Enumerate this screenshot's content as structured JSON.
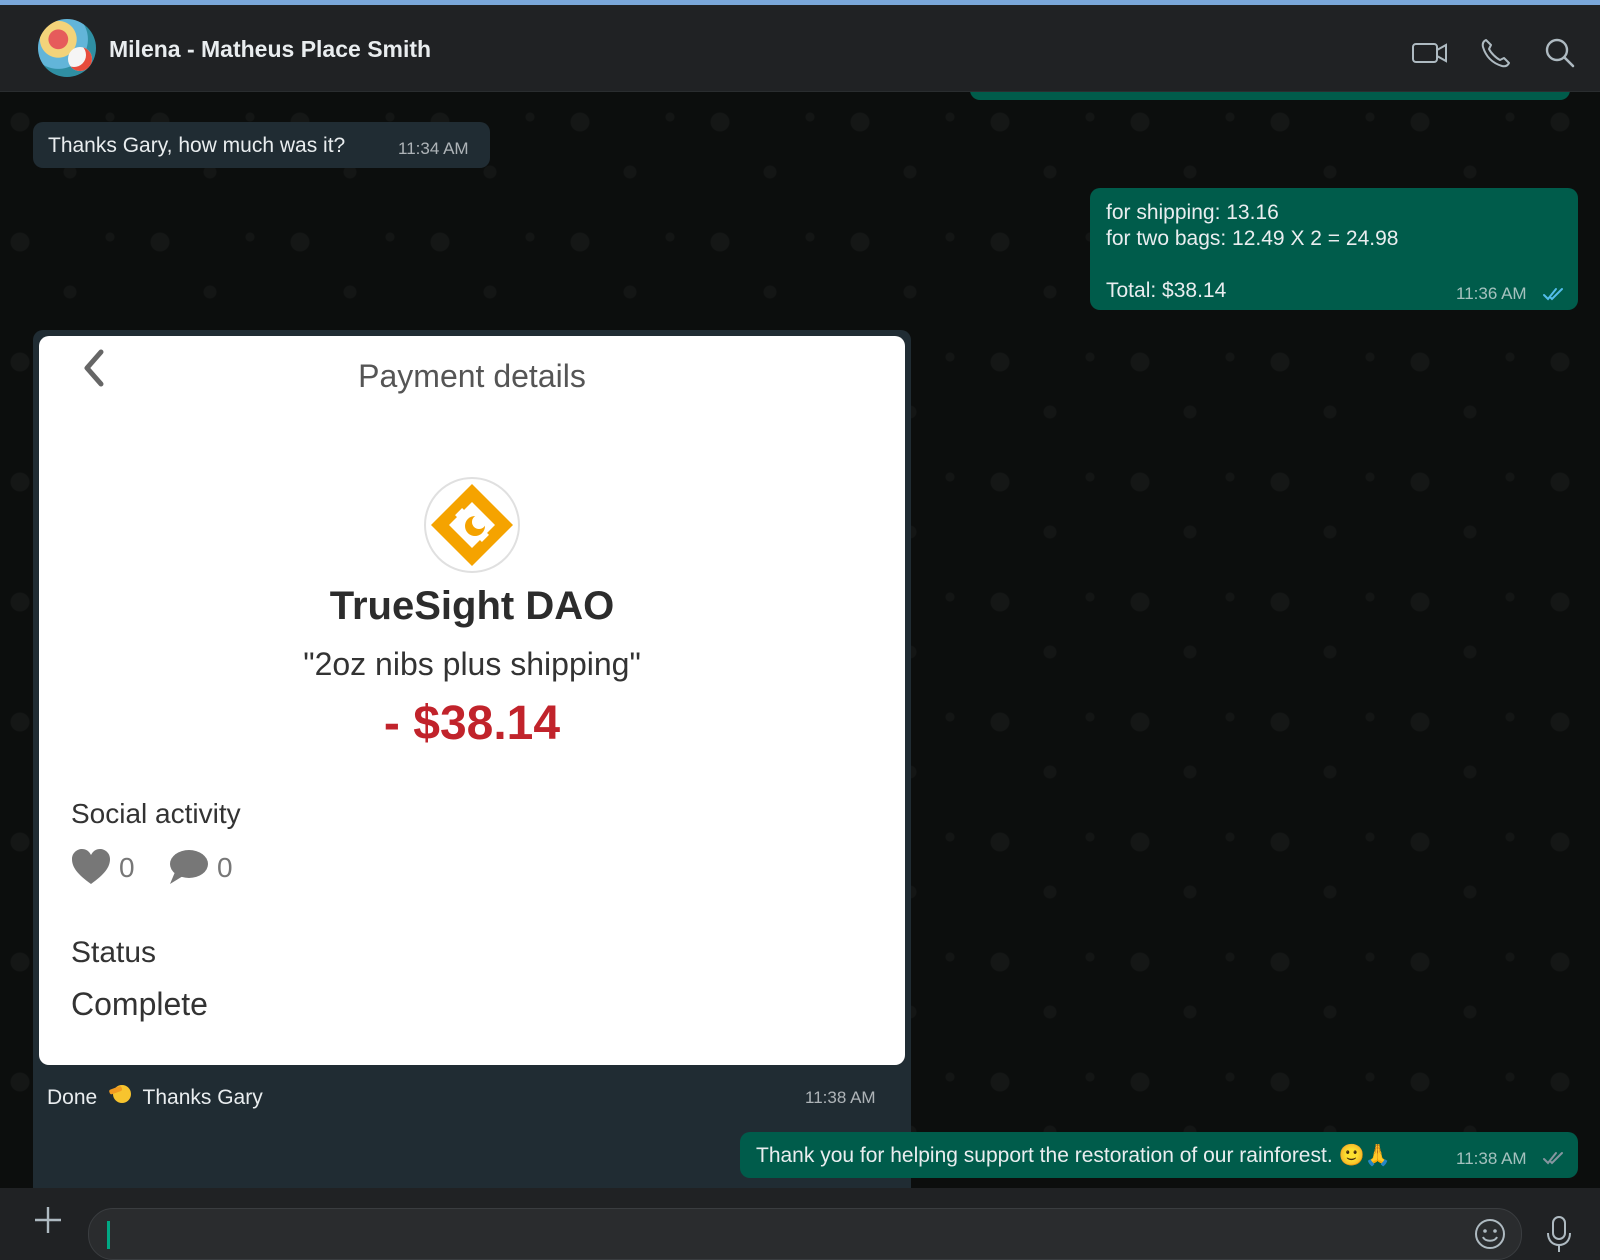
{
  "header": {
    "contact_name": "Milena - Matheus Place Smith",
    "icons": [
      "video-call-icon",
      "voice-call-icon",
      "search-icon"
    ]
  },
  "messages": [
    {
      "direction": "in",
      "text": "Thanks Gary, how much was it?",
      "time": "11:34 AM"
    },
    {
      "direction": "out",
      "lines": [
        "for shipping: 13.16",
        "for two bags: 12.49 X 2 = 24.98",
        "",
        "Total: $38.14"
      ],
      "time": "11:36 AM",
      "status": "read"
    },
    {
      "direction": "in",
      "caption_before": "Done",
      "caption_after": "Thanks Gary",
      "time": "11:38 AM"
    },
    {
      "direction": "out",
      "text": "Thank you for helping support the restoration of our rainforest. 🙂🙏",
      "time": "11:38 AM",
      "status": "delivered"
    }
  ],
  "payment": {
    "title": "Payment details",
    "merchant": "TrueSight DAO",
    "memo": "\"2oz nibs plus shipping\"",
    "amount": "- $38.14",
    "social_label": "Social activity",
    "likes": "0",
    "comments": "0",
    "status_label": "Status",
    "status_value": "Complete"
  },
  "composer": {
    "input_value": ""
  },
  "colors": {
    "outgoing_bubble": "#005c4b",
    "incoming_bubble": "#202c33",
    "amount": "#c1232b",
    "read_tick": "#53bdeb",
    "logo_orange": "#f5a300"
  }
}
